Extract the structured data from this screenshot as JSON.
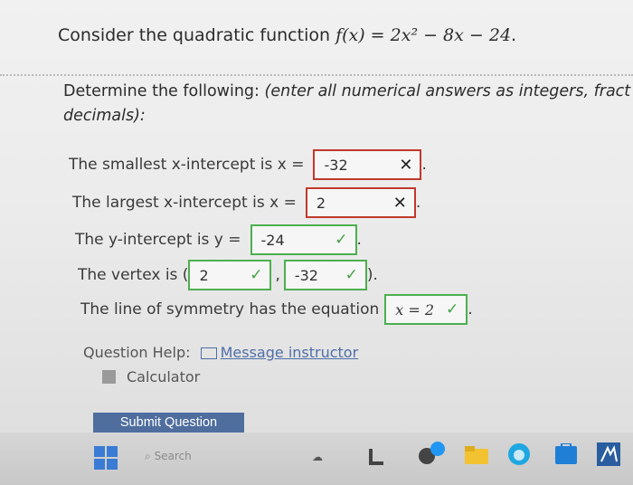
{
  "question": {
    "prefix": "Consider the quadratic function ",
    "function": "f(x) = 2x² − 8x − 24",
    "suffix": "."
  },
  "instructions": {
    "lead": "Determine the following: ",
    "italic": "(enter all numerical answers as integers, fract",
    "line2": "decimals):"
  },
  "rows": {
    "smallest": {
      "label": "The smallest x-intercept is x =",
      "value": "-32",
      "mark": "✕",
      "end": "."
    },
    "largest": {
      "label": "The largest x-intercept is x =",
      "value": "2",
      "mark": "✕",
      "end": "."
    },
    "yint": {
      "label": "The y-intercept is y =",
      "value": "-24",
      "mark": "✓",
      "end": "."
    },
    "vertex": {
      "label": "The vertex is (",
      "x": "2",
      "sep": ",",
      "y": "-32",
      "mark": "✓",
      "end": ")."
    },
    "symmetry": {
      "label": "The line of symmetry has the equation",
      "value": "x = 2",
      "mark": "✓",
      "end": "."
    }
  },
  "help": {
    "label": "Question Help:",
    "message": "Message instructor",
    "calculator": "Calculator"
  },
  "submit": "Submit Question",
  "taskbar": {
    "search": "Search"
  },
  "colors": {
    "wrong": "#c0392b",
    "right": "#4caf50",
    "button": "#4f6e9e",
    "link": "#4f6fa8"
  }
}
